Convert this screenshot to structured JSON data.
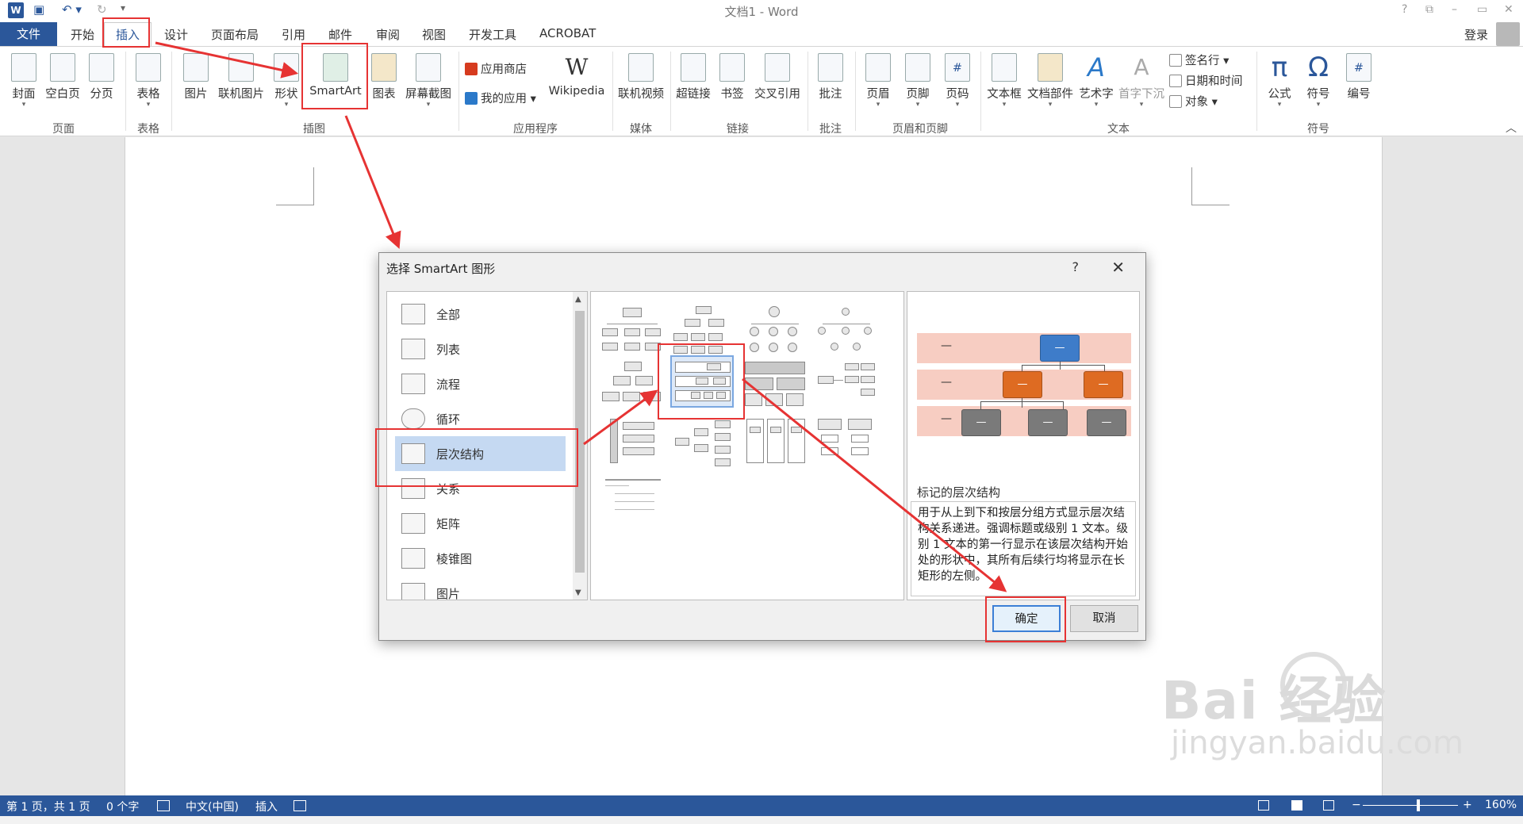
{
  "titlebar": {
    "title": "文档1 - Word",
    "qat_word": "W",
    "qat_save": "▣",
    "qat_undo": "↶ ▾",
    "qat_redo": "↻",
    "qat_more": "▾",
    "win_help": "?",
    "win_restore": "⧉",
    "win_min": "–",
    "win_max": "▭",
    "win_close": "✕"
  },
  "menubar": {
    "file": "文件",
    "tabs": [
      "开始",
      "插入",
      "设计",
      "页面布局",
      "引用",
      "邮件",
      "审阅",
      "视图",
      "开发工具",
      "ACROBAT"
    ],
    "login": "登录"
  },
  "ribbon": {
    "buttons": {
      "cover": "封面",
      "blank": "空白页",
      "pagebreak": "分页",
      "table": "表格",
      "picture": "图片",
      "online_picture": "联机图片",
      "shapes": "形状",
      "smartart": "SmartArt",
      "chart": "图表",
      "screenshot": "屏幕截图",
      "store": "应用商店",
      "myapps": "我的应用",
      "wikipedia": "Wikipedia",
      "wikipedia_glyph": "W",
      "online_video": "联机视频",
      "hyperlink": "超链接",
      "bookmark": "书签",
      "crossref": "交叉引用",
      "comment": "批注",
      "header": "页眉",
      "footer": "页脚",
      "pagenum": "页码",
      "textbox": "文本框",
      "quickparts": "文档部件",
      "wordart": "艺术字",
      "dropcap": "首字下沉",
      "signature": "签名行",
      "datetime": "日期和时间",
      "object": "对象",
      "equation": "公式",
      "symbol": "符号",
      "numbering": "编号",
      "pi_glyph": "π",
      "omega_glyph": "Ω",
      "wordart_glyph": "A",
      "dropcap_glyph": "A",
      "hash_glyph": "#"
    },
    "groups": [
      "页面",
      "表格",
      "插图",
      "应用程序",
      "媒体",
      "链接",
      "批注",
      "页眉和页脚",
      "文本",
      "符号"
    ],
    "collapse": "︿"
  },
  "dialog": {
    "title": "选择 SmartArt 图形",
    "help": "?",
    "close": "✕",
    "categories": [
      "全部",
      "列表",
      "流程",
      "循环",
      "层次结构",
      "关系",
      "矩阵",
      "棱锥图",
      "图片"
    ],
    "selected_category": "层次结构",
    "scroll_up": "▲",
    "scroll_down": "▼",
    "preview": {
      "dash": "—",
      "name": "标记的层次结构",
      "description": "用于从上到下和按层分组方式显示层次结构关系递进。强调标题或级别 1 文本。级别 1 文本的第一行显示在该层次结构开始处的形状中，其所有后续行均将显示在长矩形的左侧。"
    },
    "ok": "确定",
    "cancel": "取消"
  },
  "statusbar": {
    "page": "第 1 页，共 1 页",
    "words": "0 个字",
    "lang": "中文(中国)",
    "mode": "插入",
    "zoom_minus": "−",
    "zoom_plus": "+",
    "zoom": "160%"
  },
  "watermark": {
    "main": "Bai 经验",
    "sub": "jingyan.baidu.com"
  },
  "colors": {
    "accent": "#2b579a",
    "highlight": "#e63333",
    "selection": "#c5d9f2",
    "blue": "#3e7cc9",
    "orange": "#de6b22",
    "band": "#f7cdc2"
  }
}
